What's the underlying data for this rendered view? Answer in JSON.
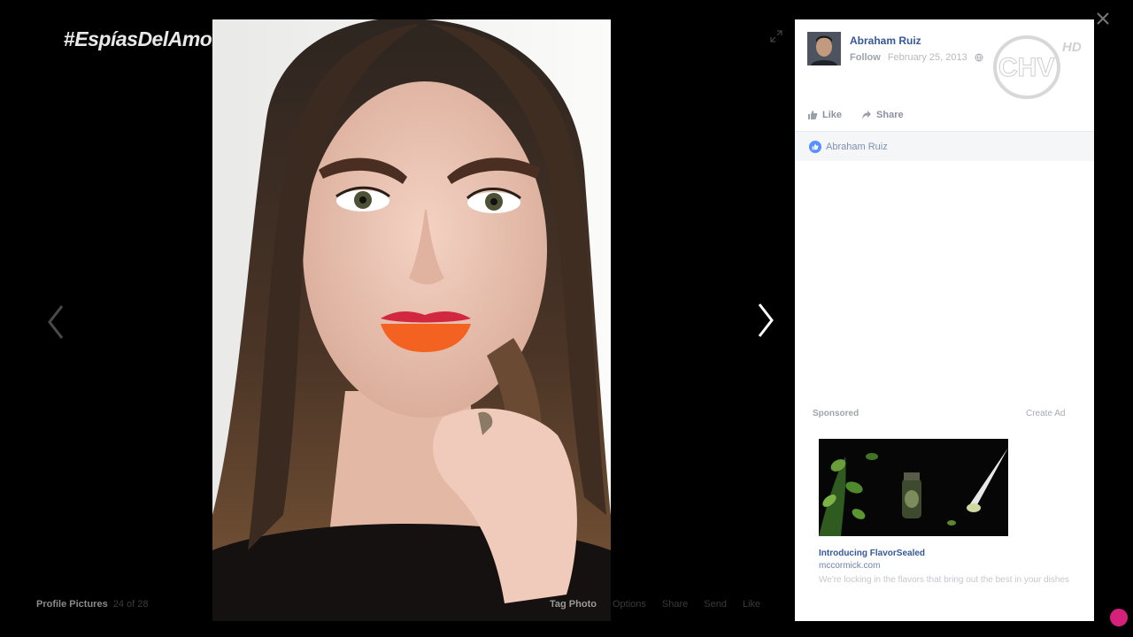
{
  "overlay": {
    "hashtag_mark": "#",
    "hashtag_text": "EspíasDelAmor"
  },
  "photo_viewer": {
    "album_name": "Profile Pictures",
    "photo_count": "24 of 28",
    "actions": [
      "Tag Photo",
      "Options",
      "Share",
      "Send",
      "Like"
    ],
    "icons": {
      "prev": "chevron-left-icon",
      "next": "chevron-right-icon",
      "expand": "expand-icon",
      "close": "close-icon"
    }
  },
  "post": {
    "author": "Abraham Ruiz",
    "follow_label": "Follow",
    "date": "February 25, 2013",
    "privacy_icon": "globe-icon",
    "like_label": "Like",
    "share_label": "Share",
    "liked_by": "Abraham Ruiz"
  },
  "watermark": {
    "logo": "CHV",
    "badge": "HD"
  },
  "ad": {
    "sponsored_label": "Sponsored",
    "create_ad_label": "Create Ad",
    "title": "Introducing FlavorSealed",
    "domain": "mccormick.com",
    "description": "We're locking in the flavors that bring out the best in your dishes"
  },
  "colors": {
    "link": "#365899",
    "like_badge": "#5890ff",
    "panel_bg": "#ffffff",
    "viewer_bg": "#000000"
  }
}
